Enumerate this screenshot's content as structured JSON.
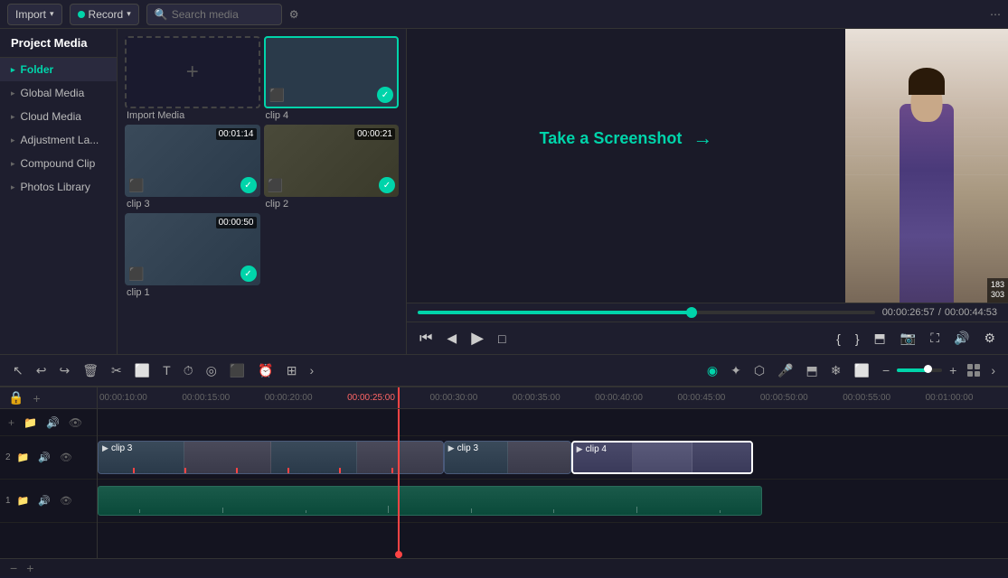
{
  "topbar": {
    "import_label": "Import",
    "record_label": "Record",
    "search_placeholder": "Search media",
    "more_icon": "⋯"
  },
  "sidebar": {
    "title": "Project Media",
    "items": [
      {
        "label": "Folder",
        "active": true
      },
      {
        "label": "Global Media",
        "active": false
      },
      {
        "label": "Cloud Media",
        "active": false
      },
      {
        "label": "Adjustment La...",
        "active": false
      },
      {
        "label": "Compound Clip",
        "active": false
      },
      {
        "label": "Photos Library",
        "active": false
      }
    ]
  },
  "media": {
    "clips": [
      {
        "label": "clip 4",
        "duration": null,
        "selected": true,
        "has_check": true
      },
      {
        "label": "clip 3",
        "duration": "00:01:14",
        "selected": false,
        "has_check": true
      },
      {
        "label": "clip 2",
        "duration": "00:00:21",
        "selected": false,
        "has_check": true
      },
      {
        "label": "clip 1",
        "duration": "00:00:50",
        "selected": false,
        "has_check": true
      }
    ]
  },
  "preview": {
    "screenshot_label": "Take a Screenshot",
    "time_current": "00:00:26:57",
    "time_total": "00:00:44:53",
    "progress_percent": 60,
    "overlay_num": "183\n303"
  },
  "timeline": {
    "playhead_position_percent": 40,
    "time_markers": [
      "00:00:10:00",
      "00:00:15:00",
      "00:00:20:00",
      "00:00:25:00",
      "00:00:30:00",
      "00:00:35:00",
      "00:00:40:00",
      "00:00:45:00",
      "00:00:50:00",
      "00:00:55:00",
      "00:01:00:00"
    ],
    "tracks": [
      {
        "id": "track1",
        "clips": [
          {
            "label": "clip 3",
            "start": 0,
            "width": 38,
            "color": "blue",
            "play_icon": true
          },
          {
            "label": "clip 3",
            "start": 38,
            "width": 14,
            "color": "blue",
            "play_icon": true
          },
          {
            "label": "clip 4",
            "start": 52,
            "width": 20,
            "color": "dark",
            "play_icon": true,
            "selected": true
          }
        ]
      }
    ],
    "cut_icon": "✂"
  },
  "toolbar": {
    "tools": [
      "↩",
      "↪",
      "🗑",
      "✂",
      "⬜",
      "T",
      "⏱",
      "◎",
      "⬛",
      "⏰",
      "⊞",
      "≋"
    ],
    "right_tools": [
      "◉",
      "✦",
      "⬡",
      "🎤",
      "⬒",
      "❄",
      "⬜",
      "−",
      "●",
      "○",
      "+",
      "⊞",
      "›"
    ]
  }
}
